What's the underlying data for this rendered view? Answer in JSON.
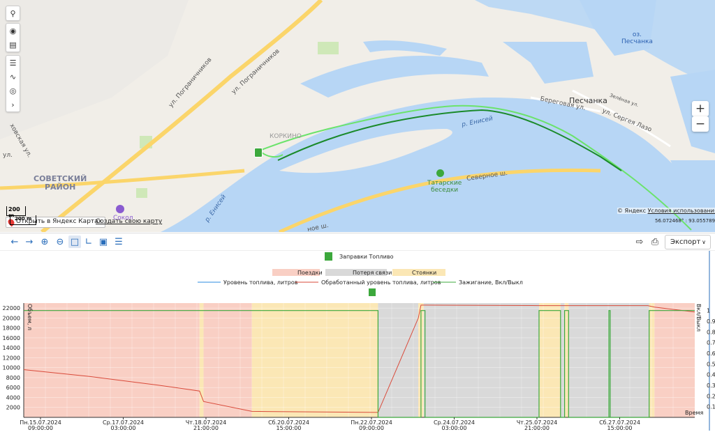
{
  "map": {
    "labels": {
      "street_pogranichnikov_1": "ул. Пограничников",
      "street_pogranichnikov_2": "ул. Пограничников",
      "street_lyubovskaya": "ховская ул.",
      "street_ul": "ул.",
      "district": "СОВЕТСКИЙ\nРАЙОН",
      "korkino": "КОРКИНО",
      "river1": "р. Енисей",
      "river2": "р. Енисей",
      "peschanka": "Песчанка",
      "beregovaya": "Береговая ул.",
      "zelenaya": "Зелёная ул.",
      "sergeya_lazo": "ул. Сергея Лазо",
      "lake": "оз.\nПесчанка",
      "tatarskie": "Татарские\nбеседки",
      "severnoe": "Северное ш.",
      "sokol": "Сокол",
      "shosse": "ное ш."
    },
    "scale_label": "200 m",
    "scale_label_2": "200 m",
    "open_in_yandex": "Открыть в Яндекс Картах",
    "create_map": "Создать свою карту",
    "copyright_prefix": "© Яндекс ",
    "copyright_link": "Условия использования",
    "coords": "56.072468° : 93.055789°",
    "zoom_in": "+",
    "zoom_out": "−",
    "colors": {
      "water": "#b7d6f5",
      "land": "#f1eee8",
      "road": "#fbd56a",
      "track_light": "#6be36b",
      "track_dark": "#1a8a2a"
    }
  },
  "toolbar": {
    "export_label": "Экспорт",
    "icons": [
      "arrow-left-icon",
      "arrow-right-icon",
      "zoom-in-icon",
      "zoom-out-icon",
      "zoom-selection-icon",
      "axis-icon",
      "fit-icon",
      "list-icon",
      "export-out-icon",
      "print-icon"
    ]
  },
  "chart_legend": {
    "top_item": "Заправки Топливо",
    "bands": [
      "Поездки",
      "Потеря связи",
      "Стоянки"
    ],
    "series": [
      "Уровень топлива, литров",
      "Обработанный уровень топлива, литров",
      "Зажигание, Вкл/Выкл"
    ]
  },
  "chart_data": {
    "type": "line",
    "ylabel_left": "Объем, л",
    "ylabel_right": "Вкл/Выкл",
    "xlabel": "Время",
    "ylim_left": [
      0,
      22000
    ],
    "ylim_right": [
      0,
      1
    ],
    "y_ticks_left": [
      2000,
      4000,
      6000,
      8000,
      10000,
      12000,
      14000,
      16000,
      18000,
      20000,
      22000
    ],
    "y_ticks_right": [
      0.1,
      0.2,
      0.3,
      0.4,
      0.5,
      0.6,
      0.7,
      0.8,
      0.9,
      1
    ],
    "x_ticks": [
      {
        "line1": "Пн.15.07.2024",
        "line2": "09:00:00"
      },
      {
        "line1": "Ср.17.07.2024",
        "line2": "03:00:00"
      },
      {
        "line1": "Чт.18.07.2024",
        "line2": "21:00:00"
      },
      {
        "line1": "Сб.20.07.2024",
        "line2": "15:00:00"
      },
      {
        "line1": "Пн.22.07.2024",
        "line2": "09:00:00"
      },
      {
        "line1": "Ср.24.07.2024",
        "line2": "03:00:00"
      },
      {
        "line1": "Чт.25.07.2024",
        "line2": "21:00:00"
      },
      {
        "line1": "Сб.27.07.2024",
        "line2": "15:00:00"
      }
    ],
    "bands": [
      {
        "type": "Поездки",
        "from": 0.0,
        "to": 0.262
      },
      {
        "type": "Стоянки",
        "from": 0.262,
        "to": 0.268
      },
      {
        "type": "Поездки",
        "from": 0.268,
        "to": 0.34
      },
      {
        "type": "Стоянки",
        "from": 0.34,
        "to": 0.528
      },
      {
        "type": "Потеря связи",
        "from": 0.528,
        "to": 0.588
      },
      {
        "type": "Стоянки",
        "from": 0.588,
        "to": 0.596
      },
      {
        "type": "Потеря связи",
        "from": 0.596,
        "to": 0.768
      },
      {
        "type": "Стоянки",
        "from": 0.768,
        "to": 0.8
      },
      {
        "type": "Потеря связи",
        "from": 0.8,
        "to": 0.806
      },
      {
        "type": "Стоянки",
        "from": 0.806,
        "to": 0.812
      },
      {
        "type": "Потеря связи",
        "from": 0.812,
        "to": 0.932
      },
      {
        "type": "Стоянки",
        "from": 0.932,
        "to": 0.94
      },
      {
        "type": "Поездки",
        "from": 0.94,
        "to": 1.0
      }
    ],
    "series": [
      {
        "name": "Обработанный уровень топлива, литров",
        "x": [
          0.0,
          0.1,
          0.2,
          0.262,
          0.268,
          0.34,
          0.528,
          0.588,
          0.592,
          0.6,
          0.77,
          0.8,
          0.93,
          0.94,
          1.0
        ],
        "y": [
          9600,
          8200,
          6500,
          5300,
          3200,
          1200,
          1000,
          20000,
          22600,
          22600,
          22500,
          22500,
          22500,
          22200,
          21200
        ]
      },
      {
        "name": "Зажигание, Вкл/Выкл",
        "x": [
          0.0,
          0.528,
          0.528,
          0.592,
          0.592,
          0.598,
          0.598,
          0.768,
          0.768,
          0.8,
          0.8,
          0.806,
          0.806,
          0.812,
          0.812,
          0.872,
          0.872,
          0.874,
          0.874,
          0.932,
          0.932,
          1.0
        ],
        "y": [
          1,
          1,
          0,
          0,
          1,
          1,
          0,
          0,
          1,
          1,
          0,
          0,
          1,
          1,
          0,
          0,
          1,
          1,
          0,
          0,
          1,
          1
        ]
      },
      {
        "name": "Уровень топлива, литров",
        "x": [],
        "y": []
      }
    ],
    "colors": {
      "Поездки": "#f9cfc4",
      "Потеря связи": "#d9d9d9",
      "Стоянки": "#fbe7b5",
      "Уровень топлива, литров": "#2b8be0",
      "Обработанный уровень топлива, литров": "#d94a3a",
      "Зажигание, Вкл/Выкл": "#3ca83c"
    }
  }
}
